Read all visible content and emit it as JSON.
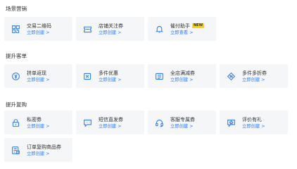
{
  "sections": [
    {
      "title": "场景营销",
      "cards": [
        {
          "name": "交易二维码",
          "link": "立即创建 >",
          "icon": "qrcode-icon"
        },
        {
          "name": "店铺关注券",
          "link": "立即创建 >",
          "icon": "ticket-icon"
        },
        {
          "name": "催付助手",
          "badge": "NEW",
          "link": "立即查看 >",
          "icon": "bell-icon"
        }
      ]
    },
    {
      "title": "提升客单",
      "cards": [
        {
          "name": "拼单返现",
          "link": "立即创建 >",
          "icon": "coin-icon"
        },
        {
          "name": "多件优惠",
          "link": "立即创建 >",
          "icon": "multi-ticket-icon"
        },
        {
          "name": "全店满减券",
          "link": "立即创建 >",
          "icon": "coupon-icon"
        },
        {
          "name": "多件多折券",
          "link": "立即创建 >",
          "icon": "discount-tag-icon"
        }
      ]
    },
    {
      "title": "提升复购",
      "cards": [
        {
          "name": "私密券",
          "link": "立即创建 >",
          "icon": "lock-icon"
        },
        {
          "name": "短信直发券",
          "link": "立即创建 >",
          "icon": "message-icon"
        },
        {
          "name": "客服专属券",
          "link": "立即创建 >",
          "icon": "headset-icon"
        },
        {
          "name": "评价有礼",
          "link": "立即创建 >",
          "icon": "review-gift-icon"
        },
        {
          "name": "订单复购商品券",
          "link": "立即创建 >",
          "icon": "order-coupon-icon"
        }
      ]
    }
  ],
  "colors": {
    "accent": "#2d7ff9",
    "card_bg": "#f5f6f7",
    "badge_bg": "#ffd400"
  }
}
